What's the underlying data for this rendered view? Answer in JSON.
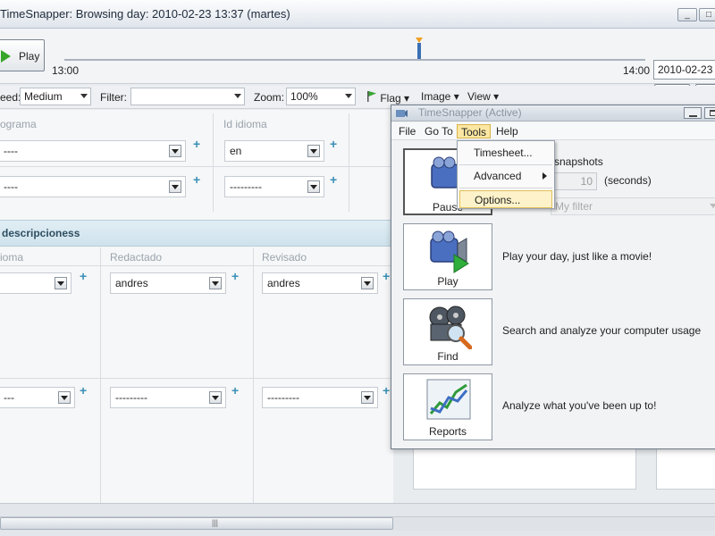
{
  "window": {
    "title": "TimeSnapper: Browsing day: 2010-02-23 13:37 (martes)",
    "controls": {
      "minimize": "_",
      "maximize": "□"
    }
  },
  "playbar": {
    "play_label": "Play",
    "time_start": "13:00",
    "time_end": "14:00",
    "date": "2010-02-23",
    "prev_label": "<<",
    "next_label": ">"
  },
  "toolbar": {
    "speed_label": "eed:",
    "speed_value": "Medium",
    "filter_label": "Filter:",
    "filter_value": "",
    "zoom_label": "Zoom:",
    "zoom_value": "100%",
    "flag_label": "Flag",
    "image_label": "Image",
    "view_label": "View"
  },
  "form": {
    "col_programa": "ograma",
    "col_idioma": "Id idioma",
    "row1": {
      "programa": "----",
      "idioma": "en"
    },
    "row2": {
      "programa": "----",
      "idioma": "---------"
    },
    "section_title": "descripcioness",
    "col_idioma2": "ioma",
    "col_redactado": "Redactado",
    "col_revisado": "Revisado",
    "row3": {
      "idioma": "",
      "redactado": "andres",
      "revisado": "andres"
    },
    "row4": {
      "idioma": "---",
      "redactado": "---------",
      "revisado": "---------"
    },
    "plus": "+"
  },
  "scrollbar": {
    "grip": "|||"
  },
  "ts": {
    "title": "TimeSnapper (Active)",
    "menu": {
      "file": "File",
      "goto": "Go To",
      "tools": "Tools",
      "help": "Help"
    },
    "dropdown": {
      "timesheet": "Timesheet...",
      "advanced": "Advanced",
      "options": "Options..."
    },
    "pause_label": "Pause",
    "snapshots_text": "snapshots",
    "interval_value": "10",
    "seconds_text": "(seconds)",
    "filter_placeholder": "My filter",
    "play_label": "Play",
    "play_desc": "Play your day, just like a movie!",
    "find_label": "Find",
    "find_desc": "Search and analyze your computer usage",
    "reports_label": "Reports",
    "reports_desc": "Analyze what you've been up to!"
  }
}
